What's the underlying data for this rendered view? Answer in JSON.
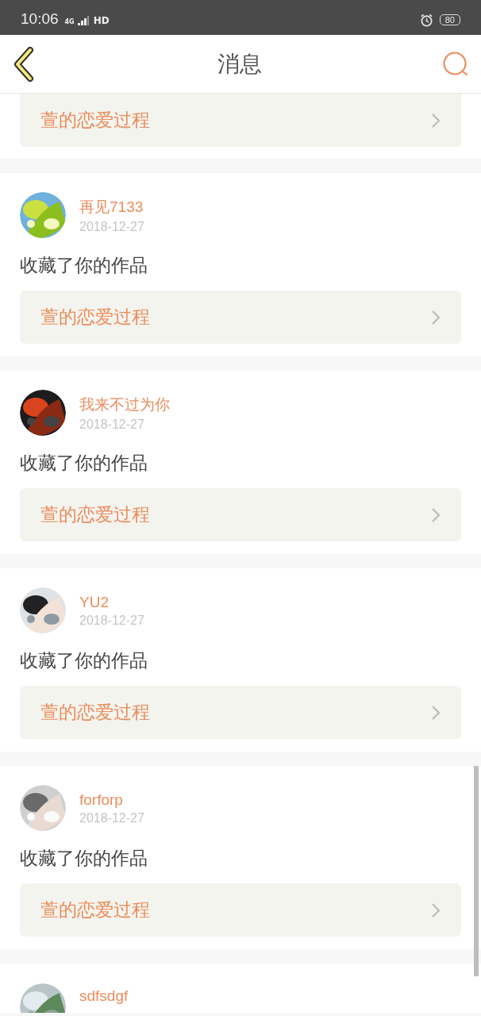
{
  "status_bar": {
    "time": "10:06",
    "network": "4G",
    "call": "HD",
    "battery": "80"
  },
  "header": {
    "title": "消息"
  },
  "messages": [
    {
      "kind": "work_only",
      "work": "萱的恋爱过程"
    },
    {
      "kind": "full",
      "user": "再见7133",
      "date": "2018-12-27",
      "action": "收藏了你的作品",
      "work": "萱的恋爱过程"
    },
    {
      "kind": "full",
      "user": "我来不过为你",
      "date": "2018-12-27",
      "action": "收藏了你的作品",
      "work": "萱的恋爱过程"
    },
    {
      "kind": "full",
      "user": "YU2",
      "date": "2018-12-27",
      "action": "收藏了你的作品",
      "work": "萱的恋爱过程"
    },
    {
      "kind": "full",
      "user": "forforp",
      "date": "2018-12-27",
      "action": "收藏了你的作品",
      "work": "萱的恋爱过程"
    },
    {
      "kind": "header_only",
      "user": "sdfsdgf"
    }
  ]
}
